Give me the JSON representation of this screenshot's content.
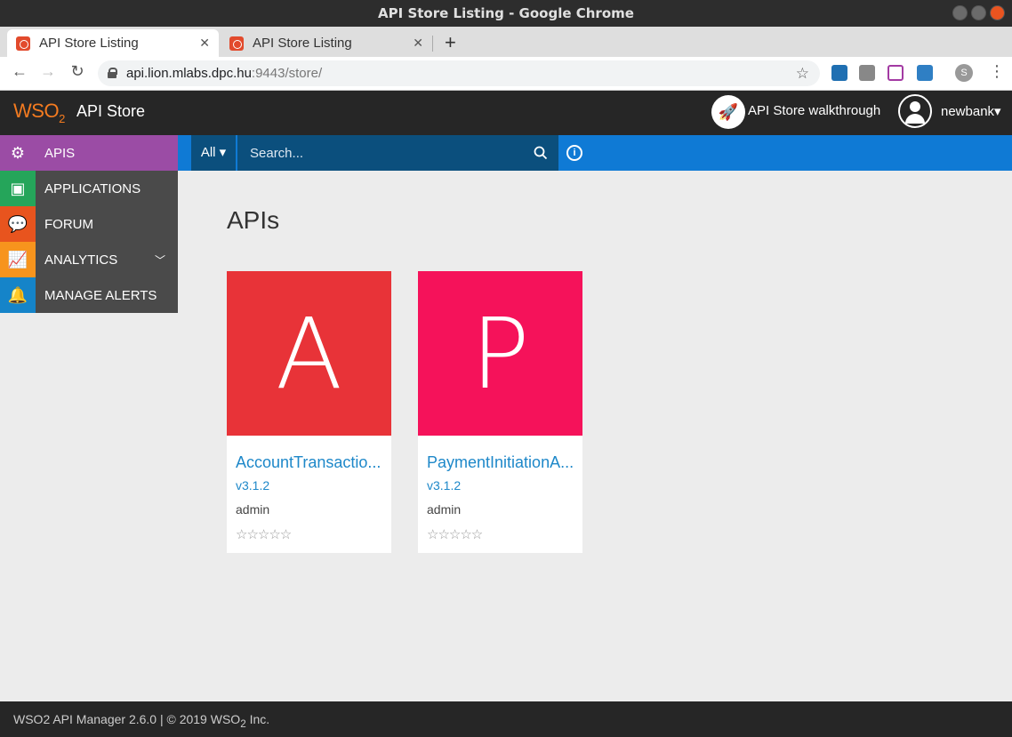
{
  "window": {
    "title": "API Store Listing - Google Chrome"
  },
  "tabs": [
    {
      "label": "API Store Listing",
      "active": true
    },
    {
      "label": "API Store Listing",
      "active": false
    }
  ],
  "address": {
    "host": "api.lion.mlabs.dpc.hu",
    "rest": ":9443/store/"
  },
  "profile": {
    "initial": "S"
  },
  "header": {
    "logo": "WSO",
    "logo_sub": "2",
    "app_name": "API Store",
    "walkthrough_label": "API Store walkthrough",
    "username": "newbank",
    "username_caret": "▾"
  },
  "sidebar": {
    "items": [
      {
        "label": "APIS",
        "icon": "api-gear-icon",
        "color": "#9b4ca5"
      },
      {
        "label": "APPLICATIONS",
        "icon": "applications-icon",
        "color": "#25a55a"
      },
      {
        "label": "FORUM",
        "icon": "forum-icon",
        "color": "#e8541e"
      },
      {
        "label": "ANALYTICS",
        "icon": "analytics-icon",
        "color": "#f7941d"
      },
      {
        "label": "MANAGE ALERTS",
        "icon": "bell-icon",
        "color": "#1584c9"
      }
    ]
  },
  "search": {
    "filter_label": "All",
    "filter_caret": "▾",
    "placeholder": "Search..."
  },
  "main": {
    "title": "APIs",
    "cards": [
      {
        "letter": "A",
        "name": "AccountTransactio...",
        "version": "v3.1.2",
        "owner": "admin",
        "rating": "☆☆☆☆☆",
        "color": "#e83338"
      },
      {
        "letter": "P",
        "name": "PaymentInitiationA...",
        "version": "v3.1.2",
        "owner": "admin",
        "rating": "☆☆☆☆☆",
        "color": "#f5125a"
      }
    ]
  },
  "footer": {
    "text_before": "WSO2 API Manager 2.6.0 | © 2019 ",
    "brand": "WSO",
    "brand_sub": "2",
    "text_after": " Inc."
  }
}
